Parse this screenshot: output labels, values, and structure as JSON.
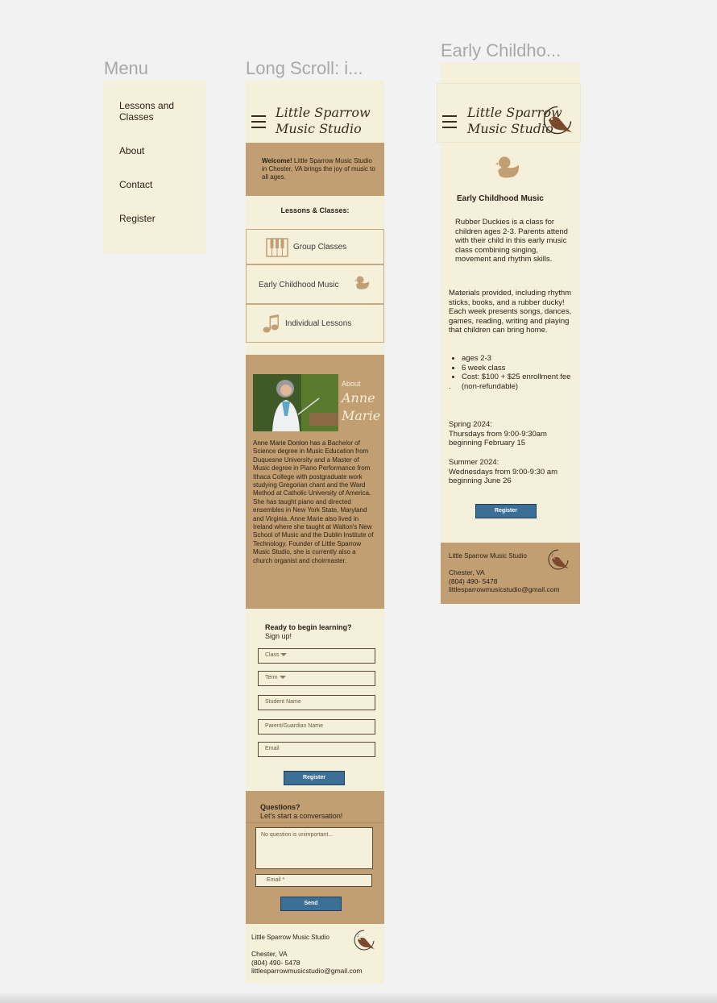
{
  "frames": {
    "menu_title": "Menu",
    "longscroll_title": "Long Scroll: i...",
    "early_title": "Early Childho..."
  },
  "menu": {
    "items": [
      "Lessons and Classes",
      "About",
      "Contact",
      "Register"
    ]
  },
  "brand": {
    "line1": "Little Sparrow",
    "line2": "Music Studio"
  },
  "long": {
    "welcome_bold": "Welcome!",
    "welcome_text": "Little Sparrow Music Studio in Chester, VA brings the joy of music to all ages.",
    "lessons_heading": "Lessons & Classes:",
    "cards": [
      "Group Classes",
      "Early Childhood Music",
      "Individual Lessons"
    ],
    "about_label": "About",
    "about_name1": "Anne",
    "about_name2": "Marie",
    "bio_name": "Anne Marie Donlon",
    "bio_text": "has a Bachelor of Science degree in Music Education from Duquesne University and a Master of Music degree in Piano Performance from Ithaca College with postgraduate work studying Gregorian chant and the Ward Method at Catholic University of America. She has taught piano and directed ensembles in New York State, Maryland and Virginia. Anne Marie also lived in Ireland where she taught at Walton's New School of Music and the Dublin Institute of Technology. Founder of Little Sparrow Music Studio, she is currently also a church organist and choirmaster.",
    "ready_heading": "Ready to begin learning?",
    "ready_sub": "Sign up!",
    "form": {
      "class": "Class",
      "term": "Term",
      "student": "Student Name",
      "parent": "Parent/Guardian Name",
      "email": "Email"
    },
    "register_btn": "Register",
    "questions_heading": "Questions?",
    "questions_sub": "Let's start a conversation!",
    "question_placeholder": "No question is unimportant...",
    "email_required": "Email *",
    "send_btn": "Send"
  },
  "footer": {
    "name": "Little Sparrow Music Studio",
    "city": "Chester, VA",
    "phone": "(804) 490- 5478",
    "email": "littlesparrowmusicstudio@gmail.com"
  },
  "early": {
    "heading": "Early Childhood Music",
    "p1": "Rubber Duckies is a class for children ages 2-3. Parents attend with their child in this early music class combining singing, movement and rhythm skills.",
    "p2": "Materials provided, including rhythm sticks, books,  and a rubber ducky! Each week presents songs, dances, games, reading, writing and playing that children can bring home.",
    "bullets": [
      "ages 2-3",
      "6 week class",
      "Cost: $100 + $25  enrollment fee"
    ],
    "nonref": ".     (non-refundable)",
    "spring_label": "Spring 2024:",
    "spring_time": "Thursdays from 9:00-9:30am",
    "spring_start": "beginning February 15",
    "summer_label": "Summer 2024:",
    "summer_time": "Wednesdays from 9:00-9:30 am",
    "summer_start": "beginning June 26",
    "register_btn": "Register"
  },
  "colors": {
    "cream": "#f4f0da",
    "tan": "#c19f72",
    "button": "#3c6f95",
    "bird": "#7a4a2c"
  },
  "icons": [
    "hamburger-icon",
    "sparrow-logo-icon",
    "piano-icon",
    "duck-icon",
    "music-note-icon",
    "dropdown-caret-icon"
  ]
}
